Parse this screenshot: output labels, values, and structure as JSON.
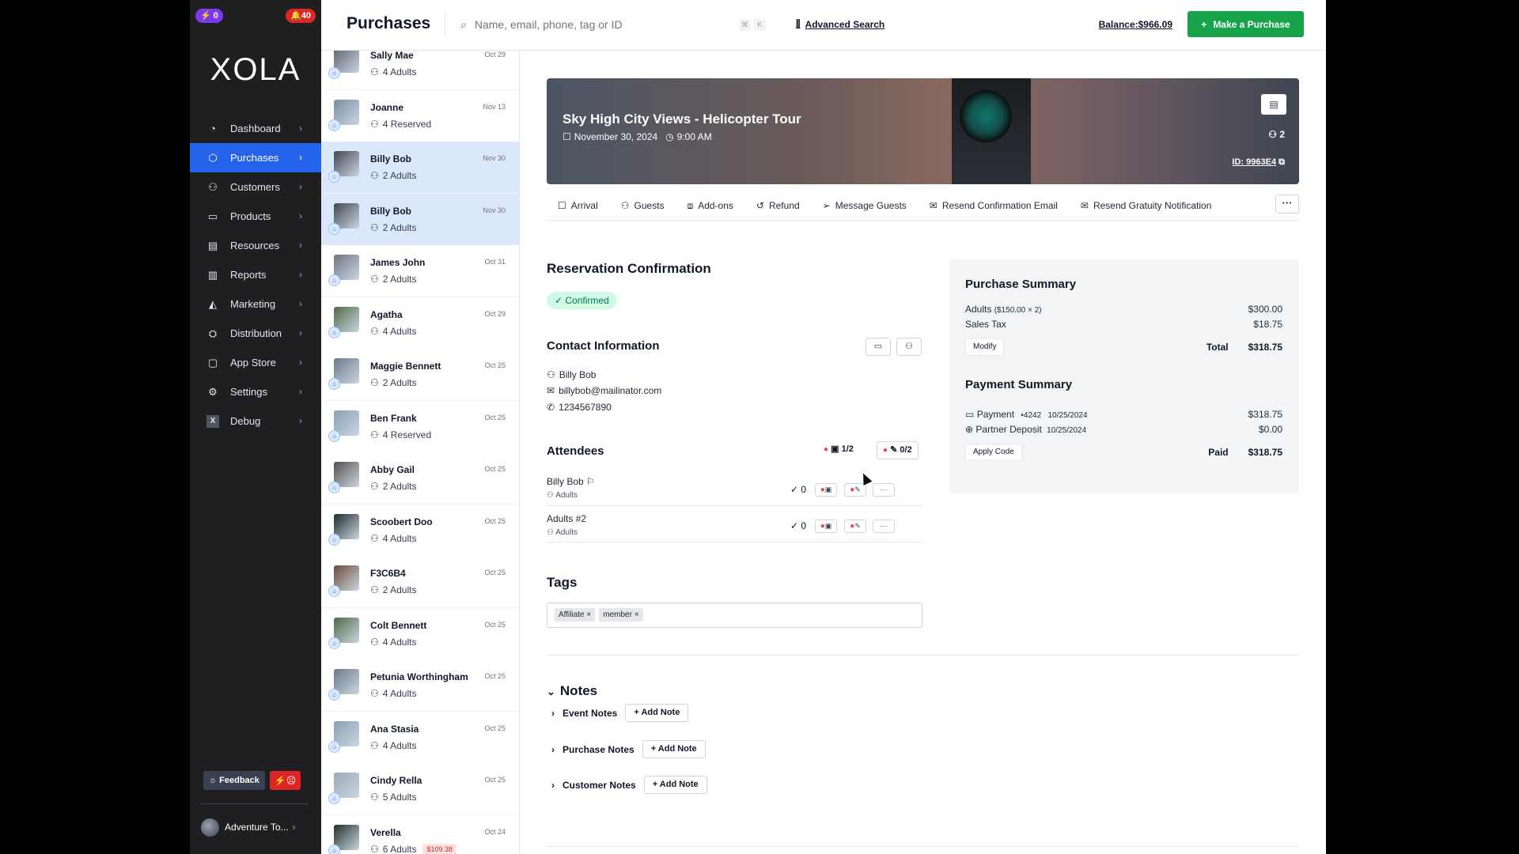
{
  "sidebar": {
    "badge_left": "0",
    "badge_right": "40",
    "logo": "XOLA",
    "items": [
      {
        "label": "Dashboard",
        "icon": "dashboard-icon"
      },
      {
        "label": "Purchases",
        "icon": "purchases-icon",
        "active": true
      },
      {
        "label": "Customers",
        "icon": "customers-icon"
      },
      {
        "label": "Products",
        "icon": "products-icon"
      },
      {
        "label": "Resources",
        "icon": "resources-icon"
      },
      {
        "label": "Reports",
        "icon": "reports-icon"
      },
      {
        "label": "Marketing",
        "icon": "marketing-icon"
      },
      {
        "label": "Distribution",
        "icon": "distribution-icon"
      },
      {
        "label": "App Store",
        "icon": "app-store-icon"
      },
      {
        "label": "Settings",
        "icon": "settings-icon"
      },
      {
        "label": "Debug",
        "icon": "debug-icon"
      }
    ],
    "feedback_label": "Feedback",
    "account_label": "Adventure To..."
  },
  "header": {
    "title": "Purchases",
    "search_placeholder": "Name, email, phone, tag or ID",
    "kbd1": "⌘",
    "kbd2": "K",
    "advanced_search": "Advanced Search",
    "balance": "Balance:$966.09",
    "make_purchase": "Make a Purchase"
  },
  "purchases": [
    {
      "name": "Sally Mae",
      "sub": "4 Adults",
      "date": "Oct 29"
    },
    {
      "name": "Joanne",
      "sub": "4 Reserved",
      "date": "Nov 13"
    },
    {
      "name": "Billy Bob",
      "sub": "2 Adults",
      "date": "Nov 30"
    },
    {
      "name": "Billy Bob",
      "sub": "2 Adults",
      "date": "Nov 30"
    },
    {
      "name": "James John",
      "sub": "2 Adults",
      "date": "Oct 31"
    },
    {
      "name": "Agatha",
      "sub": "4 Adults",
      "date": "Oct 29"
    },
    {
      "name": "Maggie Bennett",
      "sub": "2 Adults",
      "date": "Oct 25"
    },
    {
      "name": "Ben Frank",
      "sub": "4 Reserved",
      "date": "Oct 25"
    },
    {
      "name": "Abby Gail",
      "sub": "2 Adults",
      "date": "Oct 25"
    },
    {
      "name": "Scoobert Doo",
      "sub": "4 Adults",
      "date": "Oct 25"
    },
    {
      "name": "F3C6B4",
      "sub": "2 Adults",
      "date": "Oct 25"
    },
    {
      "name": "Colt Bennett",
      "sub": "4 Adults",
      "date": "Oct 25"
    },
    {
      "name": "Petunia Worthingham",
      "sub": "4 Adults",
      "date": "Oct 25"
    },
    {
      "name": "Ana Stasia",
      "sub": "4 Adults",
      "date": "Oct 25"
    },
    {
      "name": "Cindy Rella",
      "sub": "5 Adults",
      "date": "Oct 25"
    },
    {
      "name": "Verella",
      "sub": "6 Adults",
      "date": "Oct 24",
      "amount": "$109.38"
    }
  ],
  "banner": {
    "title": "Sky High City Views - Helicopter Tour",
    "date": "November 30, 2024",
    "time": "9:00 AM",
    "guests": "2",
    "id_label": "ID: 9963E4"
  },
  "actions": [
    "Arrival",
    "Guests",
    "Add-ons",
    "Refund",
    "Message Guests",
    "Resend Confirmation Email",
    "Resend Gratuity Notification"
  ],
  "reservation": {
    "title": "Reservation Confirmation",
    "status": "Confirmed"
  },
  "contact": {
    "title": "Contact Information",
    "name": "Billy Bob",
    "email": "billybob@mailinator.com",
    "phone": "1234567890"
  },
  "attendees": {
    "title": "Attendees",
    "counter_forms": "1/2",
    "counter_edits": "0/2",
    "rows": [
      {
        "name": "Billy Bob",
        "type": "Adults",
        "checks": "0"
      },
      {
        "name": "Adults #2",
        "type": "Adults",
        "checks": "0"
      }
    ]
  },
  "tags": {
    "title": "Tags",
    "items": [
      "Affiliate",
      "member"
    ]
  },
  "notes": {
    "title": "Notes",
    "rows": [
      {
        "label": "Event Notes",
        "button": "Add Note"
      },
      {
        "label": "Purchase Notes",
        "button": "Add Note"
      },
      {
        "label": "Customer Notes",
        "button": "Add Note"
      }
    ]
  },
  "purchase_summary": {
    "title": "Purchase Summary",
    "adults_label": "Adults",
    "adults_detail": "($150.00 × 2)",
    "adults_value": "$300.00",
    "tax_label": "Sales Tax",
    "tax_value": "$18.75",
    "modify": "Modify",
    "total_label": "Total",
    "total_value": "$318.75"
  },
  "payment_summary": {
    "title": "Payment Summary",
    "payment_label": "Payment",
    "card": "•4242",
    "payment_date": "10/25/2024",
    "payment_value": "$318.75",
    "deposit_label": "Partner Deposit",
    "deposit_date": "10/25/2024",
    "deposit_value": "$0.00",
    "apply_code": "Apply Code",
    "paid_label": "Paid",
    "paid_value": "$318.75"
  },
  "colors": {
    "accent_blue": "#2563eb",
    "primary_green": "#16a34a",
    "sidebar_bg": "#1f1f22",
    "danger": "#dc2626"
  }
}
